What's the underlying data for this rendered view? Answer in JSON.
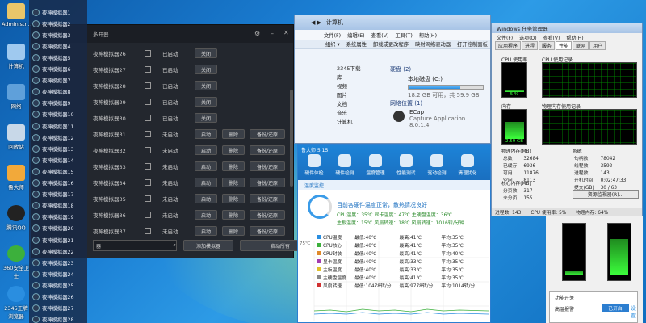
{
  "desktop": {
    "icons": [
      "Administr...",
      "计算机",
      "网络",
      "回收站",
      "鲁大师",
      "腾讯QQ",
      "360安全卫士",
      "2345王牌浏览器"
    ]
  },
  "multi_manager": {
    "title": "多开器",
    "rows": [
      {
        "name": "夜神模拟器26",
        "status": "已启动",
        "b1": "关闭"
      },
      {
        "name": "夜神模拟器27",
        "status": "已启动",
        "b1": "关闭"
      },
      {
        "name": "夜神模拟器28",
        "status": "已启动",
        "b1": "关闭"
      },
      {
        "name": "夜神模拟器29",
        "status": "已启动",
        "b1": "关闭"
      },
      {
        "name": "夜神模拟器30",
        "status": "已启动",
        "b1": "关闭"
      },
      {
        "name": "夜神模拟器31",
        "status": "未启动",
        "b1": "启动",
        "b2": "删除",
        "b3": "备份/还原"
      },
      {
        "name": "夜神模拟器32",
        "status": "未启动",
        "b1": "启动",
        "b2": "删除",
        "b3": "备份/还原"
      },
      {
        "name": "夜神模拟器33",
        "status": "未启动",
        "b1": "启动",
        "b2": "删除",
        "b3": "备份/还原"
      },
      {
        "name": "夜神模拟器34",
        "status": "未启动",
        "b1": "启动",
        "b2": "删除",
        "b3": "备份/还原"
      },
      {
        "name": "夜神模拟器35",
        "status": "未启动",
        "b1": "启动",
        "b2": "删除",
        "b3": "备份/还原"
      },
      {
        "name": "夜神模拟器36",
        "status": "未启动",
        "b1": "启动",
        "b2": "删除",
        "b3": "备份/还原"
      },
      {
        "name": "夜神模拟器37",
        "status": "未启动",
        "b1": "启动",
        "b2": "删除",
        "b3": "备份/还原"
      }
    ],
    "search_placeholder": "器",
    "add_label": "添加模拟器",
    "start_label": "启动所有"
  },
  "instance_list": [
    "夜神模拟器1",
    "夜神模拟器2",
    "夜神模拟器3",
    "夜神模拟器4",
    "夜神模拟器5",
    "夜神模拟器6",
    "夜神模拟器7",
    "夜神模拟器8",
    "夜神模拟器9",
    "夜神模拟器10",
    "夜神模拟器11",
    "夜神模拟器12",
    "夜神模拟器13",
    "夜神模拟器14",
    "夜神模拟器15",
    "夜神模拟器16",
    "夜神模拟器17",
    "夜神模拟器18",
    "夜神模拟器19",
    "夜神模拟器20",
    "夜神模拟器21",
    "夜神模拟器22",
    "夜神模拟器23",
    "夜神模拟器24",
    "夜神模拟器25",
    "夜神模拟器26",
    "夜神模拟器27",
    "夜神模拟器28"
  ],
  "explorer": {
    "path": "计算机",
    "menu": [
      "文件(F)",
      "编辑(E)",
      "查看(V)",
      "工具(T)",
      "帮助(H)"
    ],
    "toolbar": [
      "组织 ▾",
      "系统属性",
      "卸载或更改程序",
      "映射网络驱动器",
      "打开控制面板"
    ],
    "nav": [
      "2345下载",
      "库",
      "视频",
      "图片",
      "文档",
      "音乐",
      "计算机"
    ],
    "hdd_title": "硬盘 (2)",
    "drive_name": "本地磁盘 (C:)",
    "drive_free": "18.2 GB 可用，共 59.9 GB",
    "drive_fill": 0.7,
    "net_title": "网络位置 (1)",
    "ecap": "ECap",
    "ecap_desc": "Capture Application",
    "ecap_ver": "8.0.1.4"
  },
  "taskmgr": {
    "title": "Windows 任务管理器",
    "menu": [
      "文件(F)",
      "选项(O)",
      "查看(V)",
      "帮助(H)"
    ],
    "tabs": [
      "应用程序",
      "进程",
      "服务",
      "性能",
      "联网",
      "用户"
    ],
    "cpu_label": "CPU 使用率",
    "cpu_hist_label": "CPU 使用记录",
    "cpu_pct": "5 %",
    "cpu_value": 0.05,
    "mem_label": "内存",
    "mem_hist_label": "物理内存使用记录",
    "mem_val": "2.59 GB",
    "mem_value": 0.64,
    "phys_title": "物理内存(MB)",
    "phys": [
      [
        "总数",
        "32684"
      ],
      [
        "已缓存",
        "6936"
      ],
      [
        "可用",
        "11876"
      ],
      [
        "空闲",
        "8113"
      ]
    ],
    "kernel_title": "核心内存(MB)",
    "kernel": [
      [
        "分页数",
        "317"
      ],
      [
        "未分页",
        "155"
      ]
    ],
    "sys_title": "系统",
    "sys": [
      [
        "句柄数",
        "78042"
      ],
      [
        "线程数",
        "3592"
      ],
      [
        "进程数",
        "143"
      ],
      [
        "开机时间",
        "0:02:47:33"
      ],
      [
        "提交(GB)",
        "30 / 63"
      ]
    ],
    "res_btn": "资源监视器(R)...",
    "status": [
      "进程数: 143",
      "CPU 使用率: 5%",
      "物理内存: 64%"
    ]
  },
  "ludashi": {
    "title": "鲁大师 5.15",
    "tools": [
      "硬件体检",
      "硬件检测",
      "温度管理",
      "性能测试",
      "驱动检测",
      "清理优化"
    ],
    "subtab": "温度监控",
    "msg": "目前各硬件温度正常，散热情况良好",
    "line1": "CPU温度：35℃  显卡温度：47℃  主硬盘温度：36℃",
    "line2": "主板温度：15℃  风扇转速：18℃  风扇转速：1016转/分钟",
    "ylabel": "75℃",
    "temps": [
      {
        "name": "CPU温度",
        "color": "#2a8ee0",
        "min": "最低:40℃",
        "max": "最高:41℃",
        "avg": "平均:35℃"
      },
      {
        "name": "CPU核心",
        "color": "#3cb03c",
        "min": "最低:40℃",
        "max": "最高:41℃",
        "avg": "平均:35℃"
      },
      {
        "name": "CPU封装",
        "color": "#e08a2a",
        "min": "最低:40℃",
        "max": "最高:41℃",
        "avg": "平均:40℃"
      },
      {
        "name": "显卡温度",
        "color": "#a33cb0",
        "min": "最低:40℃",
        "max": "最高:33℃",
        "avg": "平均:35℃"
      },
      {
        "name": "主板温度",
        "color": "#e0c02a",
        "min": "最低:40℃",
        "max": "最高:33℃",
        "avg": "平均:35℃"
      },
      {
        "name": "主硬盘温度",
        "color": "#888888",
        "min": "最低:40℃",
        "max": "最高:41℃",
        "avg": "平均:35℃"
      },
      {
        "name": "风扇转速",
        "color": "#d03030",
        "min": "最低:10478转/分",
        "max": "最高:9778转/分",
        "avg": "平均:1014转/分"
      }
    ]
  },
  "tray": {
    "title": "功能开关",
    "label": "高温报警",
    "state": "已开启",
    "gear": "设置"
  }
}
